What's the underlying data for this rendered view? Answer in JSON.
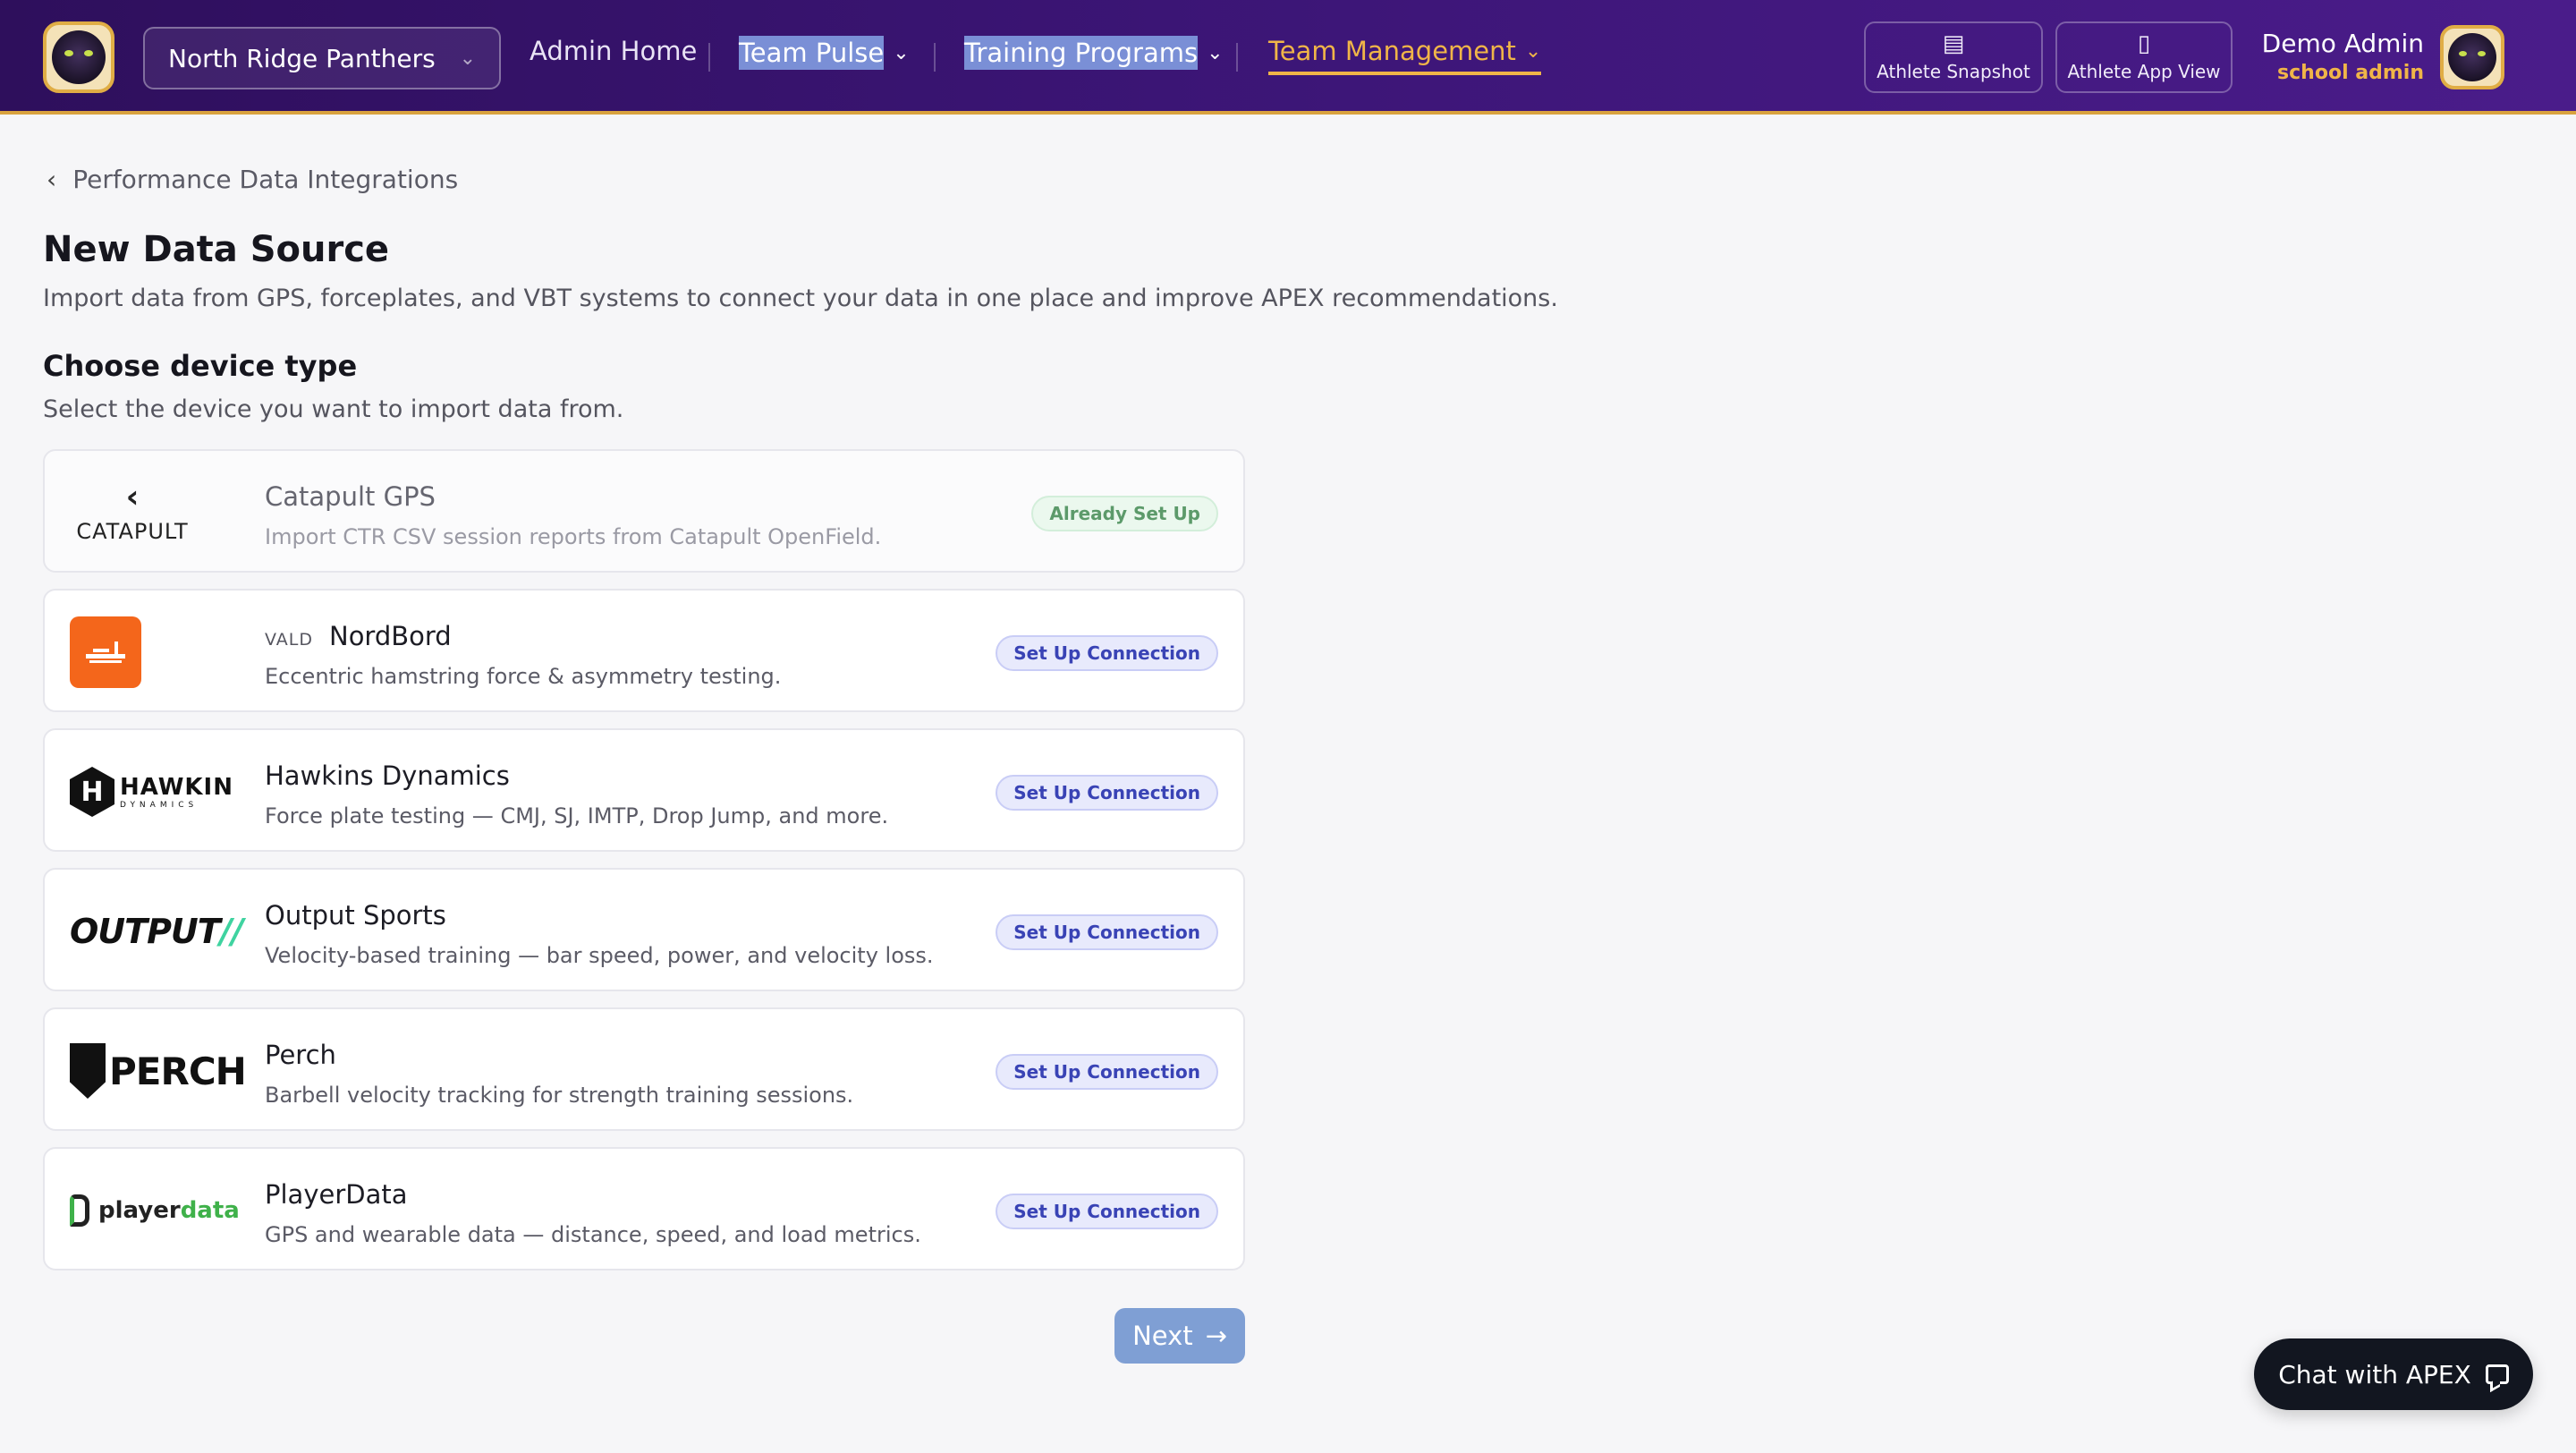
{
  "header": {
    "team": "North Ridge Panthers",
    "nav": [
      {
        "label": "Admin Home"
      },
      {
        "label": "Team Pulse"
      },
      {
        "label": "Training Programs"
      },
      {
        "label": "Team Management"
      }
    ],
    "quick_links": [
      {
        "label": "Athlete Snapshot",
        "icon": "clipboard-icon"
      },
      {
        "label": "Athlete App View",
        "icon": "phone-icon"
      }
    ],
    "user": {
      "name": "Demo Admin",
      "role": "school admin"
    }
  },
  "breadcrumb": "Performance Data Integrations",
  "page": {
    "title": "New Data Source",
    "subtitle": "Import data from GPS, forceplates, and VBT systems to connect your data in one place and improve APEX recommendations."
  },
  "section": {
    "title": "Choose device type",
    "subtitle": "Select the device you want to import data from."
  },
  "devices": [
    {
      "brand": "",
      "name": "Catapult GPS",
      "logo_text": "CATAPULT",
      "description": "Import CTR CSV session reports from Catapult OpenField.",
      "action": "Already Set Up"
    },
    {
      "brand": "VALD",
      "name": "NordBord",
      "logo_text": "",
      "description": "Eccentric hamstring force & asymmetry testing.",
      "action": "Set Up Connection"
    },
    {
      "brand": "",
      "name": "Hawkins Dynamics",
      "logo_text": "HAWKIN",
      "logo_sub": "DYNAMICS",
      "description": "Force plate testing — CMJ, SJ, IMTP, Drop Jump, and more.",
      "action": "Set Up Connection"
    },
    {
      "brand": "",
      "name": "Output Sports",
      "logo_text": "OUTPUT",
      "description": "Velocity-based training — bar speed, power, and velocity loss.",
      "action": "Set Up Connection"
    },
    {
      "brand": "",
      "name": "Perch",
      "logo_text": "PERCH",
      "description": "Barbell velocity tracking for strength training sessions.",
      "action": "Set Up Connection"
    },
    {
      "brand": "",
      "name": "PlayerData",
      "logo_text": "player",
      "logo_text_accent": "data",
      "description": "GPS and wearable data — distance, speed, and load metrics.",
      "action": "Set Up Connection"
    }
  ],
  "next_label": "Next",
  "chat_label": "Chat with APEX",
  "colors": {
    "header": "#3b1575",
    "accent": "#f0b548",
    "primary": "#7f9fd4"
  }
}
